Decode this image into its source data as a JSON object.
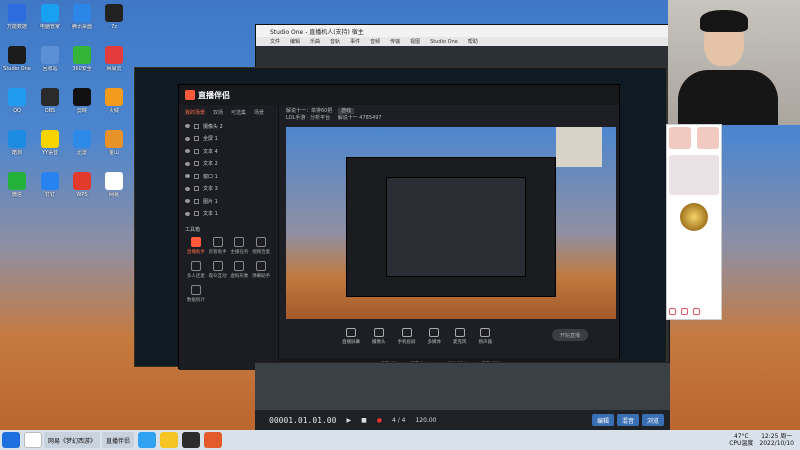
{
  "desktop": {
    "icons": [
      {
        "label": "万能数据",
        "color": "#2d6cdf"
      },
      {
        "label": "电脑管家",
        "color": "#1aa0f0"
      },
      {
        "label": "腾讯桌面",
        "color": "#2c86e8"
      },
      {
        "label": "7z",
        "color": "#222"
      },
      {
        "label": "Studio One",
        "color": "#1c1c1c"
      },
      {
        "label": "回收站",
        "color": "#5b8fd6"
      },
      {
        "label": "360安全",
        "color": "#34b53a"
      },
      {
        "label": "网易云",
        "color": "#e43c3c"
      },
      {
        "label": "QQ",
        "color": "#1f9cf0"
      },
      {
        "label": "OBS",
        "color": "#2a2a2a"
      },
      {
        "label": "剪映",
        "color": "#111"
      },
      {
        "label": "火绒",
        "color": "#f39b1c"
      },
      {
        "label": "酷狗",
        "color": "#1c8ce3"
      },
      {
        "label": "YY语音",
        "color": "#f7d400"
      },
      {
        "label": "迅雷",
        "color": "#2d8ae8"
      },
      {
        "label": "金山",
        "color": "#e8922a"
      },
      {
        "label": "微信",
        "color": "#24b23c"
      },
      {
        "label": "钉钉",
        "color": "#2883f0"
      },
      {
        "label": "WPS",
        "color": "#e23a2c"
      },
      {
        "label": "网易",
        "color": "#ffffff"
      }
    ]
  },
  "studio_one": {
    "title": "Studio One - 直播机人(支持) 宿主",
    "menu": [
      "文件",
      "编辑",
      "乐曲",
      "音轨",
      "事件",
      "音频",
      "传输",
      "视图",
      "Studio One",
      "帮助"
    ],
    "time": "00001.01.01.00",
    "bpm": "120.00",
    "signature": "4 / 4",
    "pills": [
      "编辑",
      "混音",
      "浏览"
    ]
  },
  "zhibo": {
    "logo": "直播伴侣",
    "room_title": "解说十一：单排60把",
    "tag": "游戏",
    "subtitle": "LOL手游 · 分析平台",
    "room_id": "解说十一 4785497",
    "tabs": [
      "我的场景",
      "双场",
      "可选集",
      "场景"
    ],
    "scenes": [
      "摄像头 2",
      "全屏 1",
      "文本 4",
      "文本 2",
      "窗口 1",
      "文本 3",
      "图片 1",
      "文本 1"
    ],
    "tools_title": "工具箱",
    "tools": [
      {
        "label": "直播助手",
        "hot": true
      },
      {
        "label": "房管助手",
        "hot": false
      },
      {
        "label": "主播任务",
        "hot": false
      },
      {
        "label": "视频连麦",
        "hot": false
      },
      {
        "label": "多人连麦",
        "hot": false
      },
      {
        "label": "观众互动",
        "hot": false
      },
      {
        "label": "虚拟形象",
        "hot": false
      },
      {
        "label": "弹幕助手",
        "hot": false
      },
      {
        "label": "数据统计",
        "hot": false
      }
    ],
    "bottom_buttons": [
      "直播屏幕",
      "摄像头",
      "手机投屏",
      "多媒体",
      "麦克风",
      "扬声器"
    ],
    "start_label": "开始直播",
    "status": [
      "帧率 60",
      "码率 0kb/s",
      "CPU 25%",
      "内存 50%"
    ]
  },
  "taskbar": {
    "items": [
      "网易《梦幻西游》",
      "直播伴侣"
    ],
    "temp": "47°C",
    "temp_label": "CPU温度",
    "time": "12:25 周一",
    "date": "2022/10/10"
  }
}
